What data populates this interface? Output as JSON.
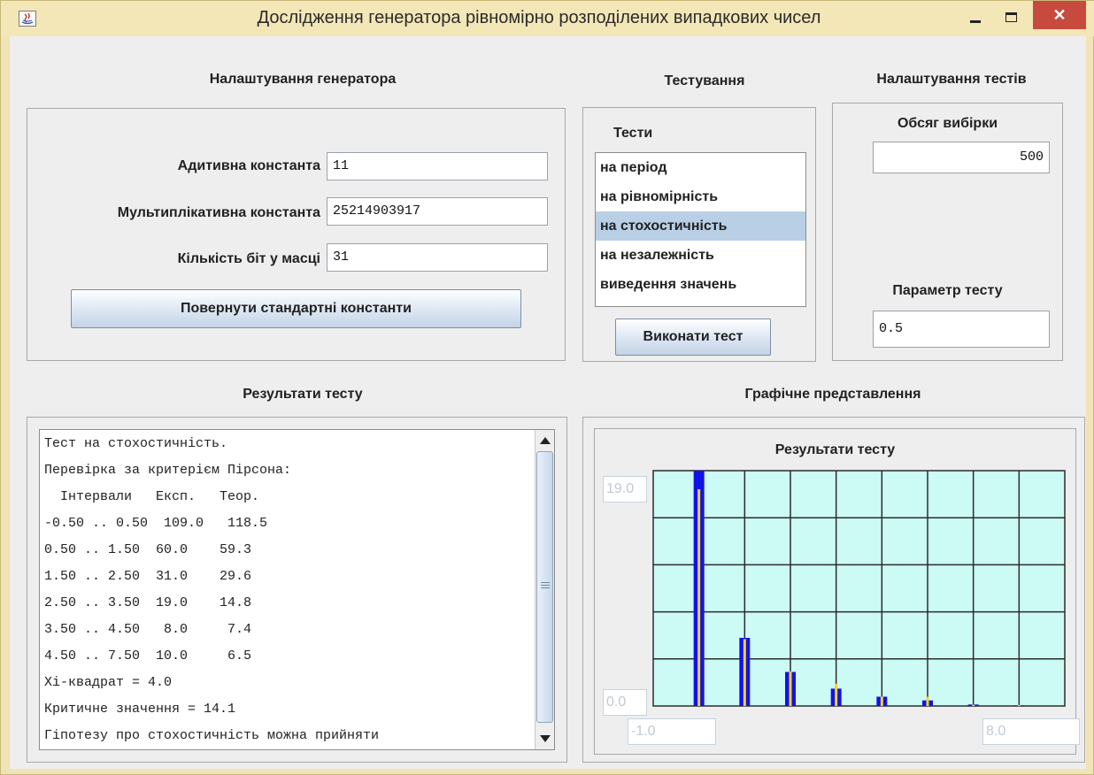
{
  "window": {
    "title": "Дослідження генератора рівномірно розподілених випадкових чисел",
    "close_glyph": "✕"
  },
  "generator": {
    "section_title": "Налаштування генератора",
    "additive_label": "Адитивна константа",
    "additive_value": "11",
    "multiplicative_label": "Мультиплікативна константа",
    "multiplicative_value": "25214903917",
    "bits_label": "Кількість біт у масці",
    "bits_value": "31",
    "reset_button": "Повернути стандартні константи"
  },
  "testing": {
    "section_title": "Тестування",
    "list_title": "Тести",
    "tests": [
      "на період",
      "на рівномірність",
      "на стохостичність",
      "на незалежність",
      "виведення значень"
    ],
    "selected_index": 2,
    "run_button": "Виконати тест"
  },
  "test_settings": {
    "section_title": "Налаштування тестів",
    "sample_size_label": "Обсяг вибірки",
    "sample_size_value": "500",
    "param_label": "Параметр тесту",
    "param_value": "0.5"
  },
  "results": {
    "section_title": "Результати тесту",
    "lines": [
      "Тест на стохостичність.",
      "Перевірка за критерієм Пірсона:",
      "  Інтервали   Експ.   Теор.",
      "-0.50 .. 0.50  109.0   118.5",
      "0.50 .. 1.50  60.0    59.3",
      "1.50 .. 2.50  31.0    29.6",
      "2.50 .. 3.50  19.0    14.8",
      "3.50 .. 4.50   8.0     7.4",
      "4.50 .. 7.50  10.0     6.5",
      "Хі-квадрат = 4.0",
      "Критичне значення = 14.1",
      "Гіпотезу про стохостичність можна прийняти"
    ]
  },
  "graph": {
    "section_title": "Графічне представлення",
    "chart_title": "Результати тесту"
  },
  "colors": {
    "plot_background": "#ccfbf6",
    "grid": "#2b2b2b",
    "experimental_bar": "#1212e6",
    "theoretical_bar": "#f2d22a"
  },
  "chart_data": {
    "type": "bar",
    "title": "Результати тесту",
    "x": [
      0,
      1,
      2,
      3,
      4,
      5,
      6,
      7
    ],
    "series": [
      {
        "values": [
          19.0,
          5.5,
          2.75,
          1.4,
          0.75,
          0.45,
          0.12,
          0.05
        ]
      },
      {
        "values": [
          17.5,
          5.4,
          2.8,
          1.8,
          0.75,
          0.75,
          0.1,
          0.08
        ]
      }
    ],
    "xlim": [
      -1.0,
      8.0
    ],
    "ylim": [
      0.0,
      19.0
    ],
    "xlim_labels": [
      "-1.0",
      "8.0"
    ],
    "ylim_labels": [
      "0.0",
      "19.0"
    ],
    "grid": true
  }
}
